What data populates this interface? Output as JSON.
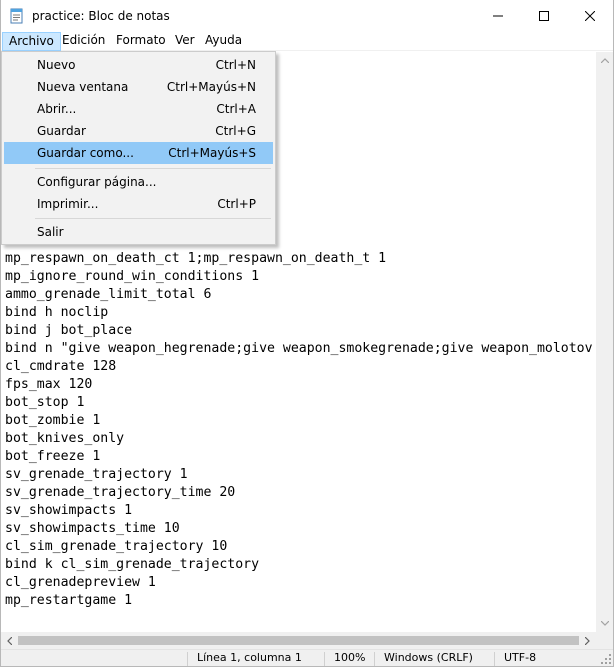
{
  "window": {
    "title": "practice: Bloc de notas"
  },
  "menubar": {
    "items": [
      {
        "label": "Archivo"
      },
      {
        "label": "Edición"
      },
      {
        "label": "Formato"
      },
      {
        "label": "Ver"
      },
      {
        "label": "Ayuda"
      }
    ]
  },
  "file_menu": {
    "items": [
      {
        "label": "Nuevo",
        "shortcut": "Ctrl+N"
      },
      {
        "label": "Nueva ventana",
        "shortcut": "Ctrl+Mayús+N"
      },
      {
        "label": "Abrir...",
        "shortcut": "Ctrl+A"
      },
      {
        "label": "Guardar",
        "shortcut": "Ctrl+G"
      },
      {
        "label": "Guardar como...",
        "shortcut": "Ctrl+Mayús+S"
      },
      {
        "label": "Configurar página...",
        "shortcut": ""
      },
      {
        "label": "Imprimir...",
        "shortcut": "Ctrl+P"
      },
      {
        "label": "Salir",
        "shortcut": ""
      }
    ],
    "highlighted": "Guardar como..."
  },
  "editor": {
    "lines": [
      "mp_respawn_on_death_ct 1;mp_respawn_on_death_t 1",
      "mp_ignore_round_win_conditions 1",
      "ammo_grenade_limit_total 6",
      "bind h noclip",
      "bind j bot_place",
      "bind n \"give weapon_hegrenade;give weapon_smokegrenade;give weapon_molotov",
      "cl_cmdrate 128",
      "fps_max 120",
      "bot_stop 1",
      "bot_zombie 1",
      "bot_knives_only",
      "bot_freeze 1",
      "sv_grenade_trajectory 1",
      "sv_grenade_trajectory_time 20",
      "sv_showimpacts 1",
      "sv_showimpacts_time 10",
      "cl_sim_grenade_trajectory 10",
      "bind k cl_sim_grenade_trajectory",
      "cl_grenadepreview 1",
      "mp_restartgame 1"
    ]
  },
  "statusbar": {
    "position": "Línea 1, columna 1",
    "zoom": "100%",
    "line_ending": "Windows (CRLF)",
    "encoding": "UTF-8"
  },
  "colors": {
    "menu_highlight": "#91c9f7",
    "menubar_active": "#cce8ff"
  }
}
